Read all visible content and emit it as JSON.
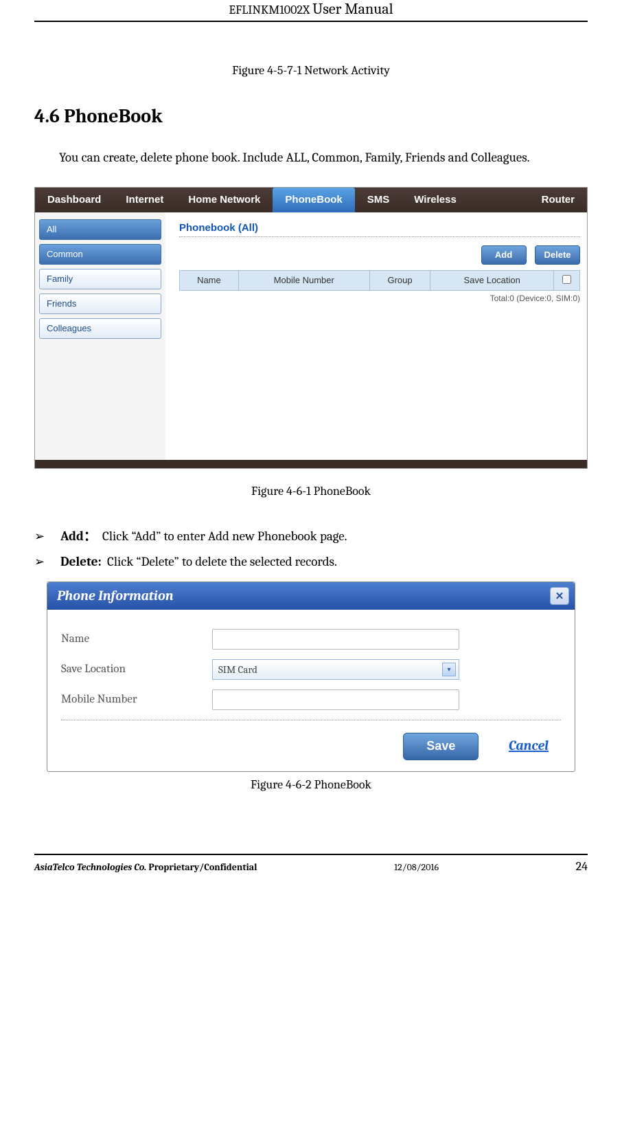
{
  "header": {
    "doc_title_a": "EFLINKM1002X",
    "doc_title_b": "User Manual"
  },
  "caption_prev": "Figure 4-5-7-1 Network Activity",
  "section_title": "4.6 PhoneBook",
  "intro_text": "You can create, delete phone book. Include ALL, Common, Family, Friends and Colleagues.",
  "router_ui": {
    "nav": [
      "Dashboard",
      "Internet",
      "Home Network",
      "PhoneBook",
      "SMS",
      "Wireless",
      "Router"
    ],
    "nav_active_index": 3,
    "sidebar": [
      {
        "label": "All",
        "selected": true
      },
      {
        "label": "Common",
        "selected": true
      },
      {
        "label": "Family",
        "selected": false
      },
      {
        "label": "Friends",
        "selected": false
      },
      {
        "label": "Colleagues",
        "selected": false
      }
    ],
    "panel_title": "Phonebook (All)",
    "buttons": {
      "add": "Add",
      "delete": "Delete"
    },
    "columns": [
      "Name",
      "Mobile Number",
      "Group",
      "Save Location"
    ],
    "totals_line": "Total:0 (Device:0, SIM:0)"
  },
  "caption_fig1": "Figure 4-6-1 PhoneBook",
  "bullets": [
    {
      "bold": "Add：",
      "text": "Click “Add” to enter Add new Phonebook page."
    },
    {
      "bold": "Delete:",
      "text": " Click “Delete” to delete the selected records."
    }
  ],
  "dialog": {
    "title": "Phone Information",
    "fields": {
      "name_label": "Name",
      "save_loc_label": "Save Location",
      "save_loc_value": "SIM Card",
      "mobile_label": "Mobile Number"
    },
    "actions": {
      "save": "Save",
      "cancel": "Cancel"
    }
  },
  "caption_fig2": "Figure 4-6-2 PhoneBook",
  "footer": {
    "company": "AsiaTelco Technologies Co.",
    "classification": "Proprietary/Confidential",
    "date": "12/08/2016",
    "page": "24"
  }
}
